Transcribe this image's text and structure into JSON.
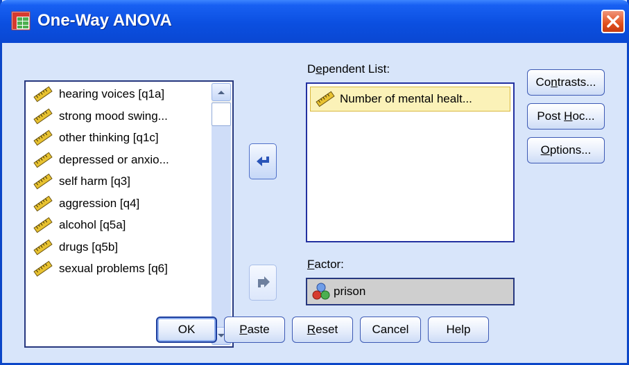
{
  "window": {
    "title": "One-Way ANOVA",
    "accent_color": "#0b46c8",
    "close_icon": "close-icon",
    "title_icon": "table-icon"
  },
  "source_list": {
    "items": [
      {
        "label": "hearing voices  [q1a]",
        "icon": "ruler-icon"
      },
      {
        "label": "strong mood swing...",
        "icon": "ruler-icon"
      },
      {
        "label": "other thinking [q1c]",
        "icon": "ruler-icon"
      },
      {
        "label": "depressed or anxio...",
        "icon": "ruler-icon"
      },
      {
        "label": "self harm [q3]",
        "icon": "ruler-icon"
      },
      {
        "label": "aggression [q4]",
        "icon": "ruler-icon"
      },
      {
        "label": "alcohol [q5a]",
        "icon": "ruler-icon"
      },
      {
        "label": "drugs [q5b]",
        "icon": "ruler-icon"
      },
      {
        "label": "sexual problems [q6]",
        "icon": "ruler-icon"
      }
    ]
  },
  "dependent_list": {
    "label_pre": "D",
    "label_u": "e",
    "label_post": "pendent List:",
    "items": [
      {
        "label": "Number of mental healt...",
        "icon": "ruler-icon"
      }
    ]
  },
  "factor": {
    "label_u": "F",
    "label_post": "actor:",
    "value": "prison",
    "icon": "nominal-icon"
  },
  "side_buttons": {
    "contrasts": {
      "pre": "Co",
      "u": "n",
      "post": "trasts..."
    },
    "post_hoc": {
      "pre": "Post ",
      "u": "H",
      "post": "oc..."
    },
    "options": {
      "pre": "",
      "u": "O",
      "post": "ptions..."
    }
  },
  "bottom_buttons": {
    "ok": "OK",
    "paste": {
      "pre": "",
      "u": "P",
      "post": "aste"
    },
    "reset": {
      "pre": "",
      "u": "R",
      "post": "eset"
    },
    "cancel": "Cancel",
    "help": "Help"
  }
}
